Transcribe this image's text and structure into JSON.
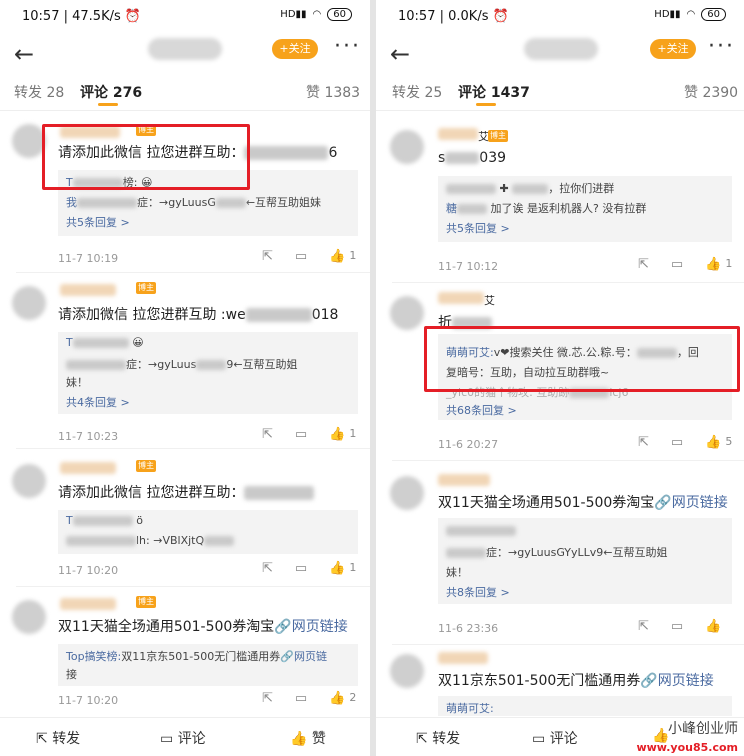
{
  "left": {
    "status": {
      "time": "10:57",
      "speed": "47.5K/s",
      "battery": "60"
    },
    "follow_label": "+关注",
    "tabs": {
      "repost": "转发 28",
      "comment": "评论 276",
      "like": "赞 1383"
    },
    "comments": [
      {
        "text": "请添加此微信 拉您进群互助：",
        "text_tail": "6",
        "reply1_name": "T",
        "reply1_tail": "榜:",
        "reply2_name": "我",
        "reply2_text": "症：→gyLuusG",
        "reply2_tail": "←互帮互助姐妹",
        "more": "共5条回复 >",
        "time": "11-7 10:19",
        "likes": "1"
      },
      {
        "text": "请添加微信 拉您进群互助 :we",
        "text_tail": "018",
        "reply1_name": "T",
        "reply2_text": "症：→gyLuus",
        "reply2_tail": "9←互帮互助姐",
        "reply2_line2": "妹！",
        "more": "共4条回复 >",
        "time": "11-7 10:23",
        "likes": "1"
      },
      {
        "text": "请添加此微信 拉您进群互助：",
        "reply1_name": "T",
        "reply1_tail": "ö",
        "reply2_text": "lh: →VBlXjtQ",
        "more": "",
        "time": "11-7 10:20",
        "likes": "1"
      },
      {
        "text": "双11天猫全场通用501-500券淘宝",
        "link": "🔗网页链接",
        "reply1_name": "Top搞笑榜:",
        "reply1_text": "双11京东501-500无门槛通用券",
        "reply1_link": "🔗网页链",
        "reply1_line2": "接",
        "more": "",
        "time": "11-7 10:20",
        "likes": "2"
      }
    ],
    "bottom": {
      "repost": "转发",
      "comment": "评论",
      "like": "赞"
    }
  },
  "right": {
    "status": {
      "time": "10:57",
      "speed": "0.0K/s",
      "battery": "60"
    },
    "follow_label": "+关注",
    "tabs": {
      "repost": "转发 25",
      "comment": "评论 1437",
      "like": "赞 2390"
    },
    "comments": [
      {
        "name_tail": "艾",
        "text": "s",
        "text_tail": "039",
        "reply1_text": "，拉你们进群",
        "reply2_name": "糖",
        "reply2_text": "加了诶 是返利机器人? 没有拉群",
        "more": "共5条回复 >",
        "time": "11-7 10:12",
        "likes": "1"
      },
      {
        "name_tail": "艾",
        "text": "折",
        "reply1_name": "萌萌可艾:",
        "reply1_text": "v❤搜索关住 微.芯.公.粽.号：",
        "reply1_tail": "，回",
        "reply1_line2": "复暗号：互助，自动拉互助群哦~",
        "reply2_text": "_ylc0的猫个物攻: 互助跡",
        "reply2_tail": "lcj6",
        "more": "共68条回复 >",
        "time": "11-6 20:27",
        "likes": "5"
      },
      {
        "text": "双11天猫全场通用501-500券淘宝",
        "link": "🔗网页链接",
        "reply2_text": "症：→gyLuusGYyLLv9←互帮互助姐",
        "reply2_line2": "妹！",
        "more": "共8条回复 >",
        "time": "11-6 23:36",
        "likes": ""
      },
      {
        "text": "双11京东501-500无门槛通用券",
        "link": "🔗网页链接",
        "reply1_name": "萌萌可艾:",
        "time": "",
        "likes": ""
      }
    ],
    "bottom": {
      "repost": "转发",
      "comment": "评论",
      "like": "赞"
    },
    "watermark": "小峰创业师",
    "watermark_site": "www.you85.com"
  }
}
